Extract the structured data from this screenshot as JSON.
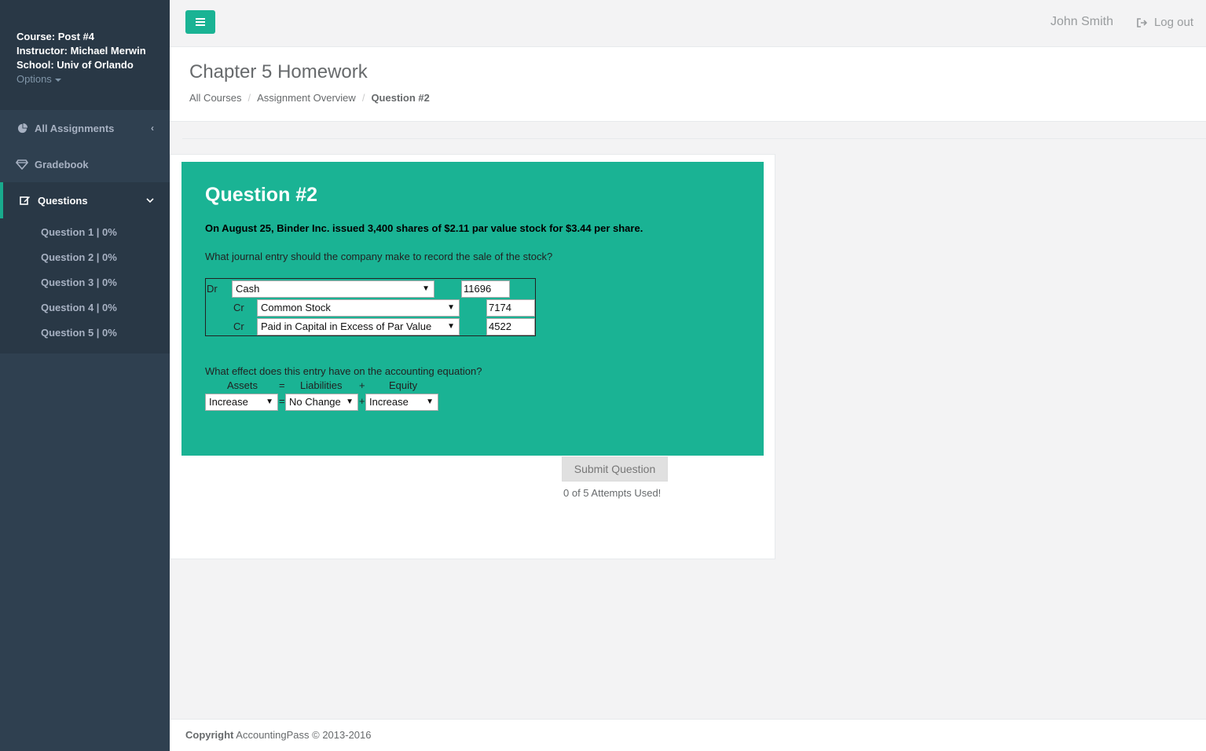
{
  "sidebar": {
    "course": "Course: Post #4",
    "instructor": "Instructor: Michael Merwin",
    "school": "School: Univ of Orlando",
    "options": "Options",
    "nav": [
      {
        "label": "All Assignments",
        "icon": "pie-chart-icon"
      },
      {
        "label": "Gradebook",
        "icon": "diamond-icon"
      },
      {
        "label": "Questions",
        "icon": "edit-icon"
      }
    ],
    "questions": [
      "Question 1 | 0%",
      "Question 2 | 0%",
      "Question 3 | 0%",
      "Question 4 | 0%",
      "Question 5 | 0%"
    ]
  },
  "topbar": {
    "user": "John Smith",
    "logout": "Log out"
  },
  "heading": {
    "title": "Chapter 5 Homework",
    "breadcrumb": [
      "All Courses",
      "Assignment Overview",
      "Question #2"
    ]
  },
  "question": {
    "title": "Question #2",
    "statement": "On August 25, Binder Inc. issued 3,400 shares of $2.11 par value stock for $3.44 per share.",
    "prompt": "What journal entry should the company make to record the sale of the stock?",
    "entries": [
      {
        "side": "Dr",
        "account": "Cash",
        "amount": "11696"
      },
      {
        "side": "Cr",
        "account": "Common Stock",
        "amount": "7174"
      },
      {
        "side": "Cr",
        "account": "Paid in Capital in Excess of Par Value",
        "amount": "4522"
      }
    ],
    "equation_prompt": "What effect does this entry have on the accounting equation?",
    "equation_headers": {
      "assets": "Assets",
      "eq": "=",
      "liabilities": "Liabilities",
      "plus": "+",
      "equity": "Equity"
    },
    "equation_values": {
      "assets": "Increase",
      "liabilities": "No Change",
      "equity": "Increase"
    }
  },
  "submit": {
    "label": "Submit Question",
    "attempts": "0 of 5 Attempts Used!"
  },
  "footer": {
    "bold": "Copyright",
    "text": "AccountingPass © 2013-2016"
  },
  "colors": {
    "sidebar": "#2f4050",
    "accent": "#1ab394"
  }
}
